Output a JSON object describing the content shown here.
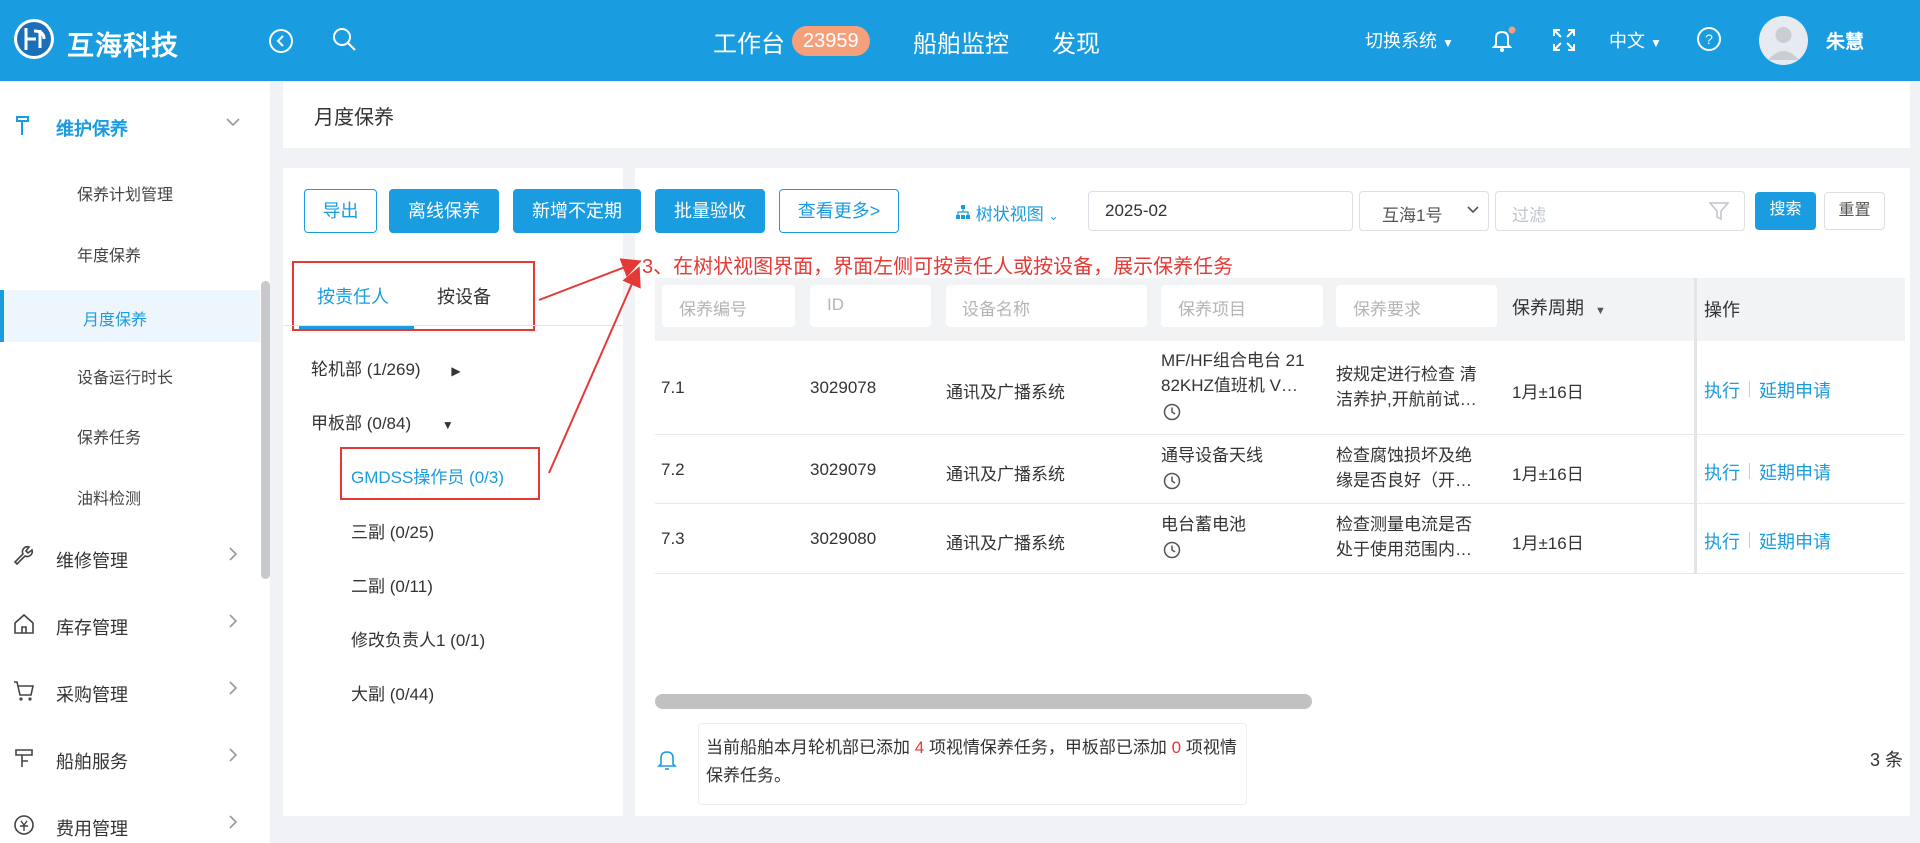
{
  "header": {
    "brand": "互海科技",
    "nav": [
      {
        "label": "工作台",
        "badge": "23959"
      },
      {
        "label": "船舶监控"
      },
      {
        "label": "发现"
      }
    ],
    "switch_system": "切换系统",
    "language": "中文",
    "user_name": "朱慧",
    "brand_color": "#1a9ce0"
  },
  "sidebar": {
    "groups": [
      {
        "label": "维护保养",
        "icon": "hammer-icon",
        "expanded": true
      },
      {
        "label": "维修管理",
        "icon": "wrench-icon"
      },
      {
        "label": "库存管理",
        "icon": "home-icon"
      },
      {
        "label": "采购管理",
        "icon": "cart-icon"
      },
      {
        "label": "船舶服务",
        "icon": "crane-icon"
      },
      {
        "label": "费用管理",
        "icon": "coin-icon"
      }
    ],
    "items": [
      "保养计划管理",
      "年度保养",
      "月度保养",
      "设备运行时长",
      "保养任务",
      "油料检测"
    ],
    "active_item": "月度保养"
  },
  "page": {
    "title": "月度保养"
  },
  "toolbar": {
    "buttons": [
      "导出",
      "离线保养",
      "新增不定期",
      "批量验收",
      "查看更多>"
    ],
    "tree_view": "树状视图",
    "month": "2025-02",
    "vessel": "互海1号",
    "filter_placeholder": "过滤",
    "search": "搜索",
    "reset": "重置"
  },
  "tree": {
    "tabs": [
      "按责任人",
      "按设备"
    ],
    "active_tab": "按责任人",
    "nodes": [
      {
        "label": "轮机部 (1/269)",
        "level": 0,
        "state": "collapsed"
      },
      {
        "label": "甲板部 (0/84)",
        "level": 0,
        "state": "expanded"
      },
      {
        "label": "GMDSS操作员 (0/3)",
        "level": 1,
        "selected": true
      },
      {
        "label": "三副 (0/25)",
        "level": 1
      },
      {
        "label": "二副 (0/11)",
        "level": 1
      },
      {
        "label": "修改负责人1 (0/1)",
        "level": 1
      },
      {
        "label": "大副 (0/44)",
        "level": 1
      }
    ]
  },
  "annotation": "3、在树状视图界面，界面左侧可按责任人或按设备，展示保养任务",
  "table": {
    "filter_placeholders": [
      "保养编号",
      "ID",
      "设备名称",
      "保养项目",
      "保养要求"
    ],
    "period_header": "保养周期",
    "action_header": "操作",
    "rows": [
      {
        "code": "7.1",
        "id": "3029078",
        "equipment": "通讯及广播系统",
        "item_l1": "MF/HF组合电台 21",
        "item_l2": "82KHZ值班机 V…",
        "req_l1": "按规定进行检查 清",
        "req_l2": "洁养护,开航前试…",
        "period": "1月±16日"
      },
      {
        "code": "7.2",
        "id": "3029079",
        "equipment": "通讯及广播系统",
        "item_l1": "通导设备天线",
        "req_l1": "检查腐蚀损坏及绝",
        "req_l2": "缘是否良好（开…",
        "period": "1月±16日"
      },
      {
        "code": "7.3",
        "id": "3029080",
        "equipment": "通讯及广播系统",
        "item_l1": "电台蓄电池",
        "req_l1": "检查测量电流是否",
        "req_l2": "处于使用范围内…",
        "period": "1月±16日"
      }
    ],
    "actions": [
      "执行",
      "延期申请"
    ]
  },
  "notice": {
    "p1": "当前船舶本月轮机部已添加",
    "n1": "4",
    "p2": "项视情保养任务，甲板部已添加",
    "n2": "0",
    "p3": "项视情保养任务。"
  },
  "total": "3 条"
}
